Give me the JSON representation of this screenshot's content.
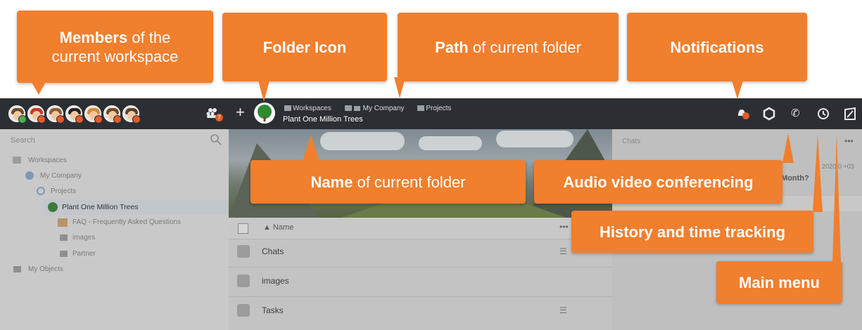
{
  "topbar": {
    "avatars": [
      {
        "hair": "#6b4a2b",
        "badge": "#4caf50"
      },
      {
        "hair": "#c0392b",
        "badge": "#e35b2b"
      },
      {
        "hair": "#8e5a3c",
        "badge": "#e35b2b"
      },
      {
        "hair": "#222222",
        "badge": "#e35b2b"
      },
      {
        "hair": "#d08a3a",
        "badge": "#e35b2b"
      },
      {
        "hair": "#6b4a2b",
        "badge": "#e35b2b"
      },
      {
        "hair": "#5a3d2b",
        "badge": "#e35b2b"
      }
    ],
    "members_count": "7",
    "breadcrumb": [
      "Workspaces",
      "My Company",
      "Projects"
    ],
    "folder_name": "Plant One Million Trees"
  },
  "left": {
    "search_placeholder": "Search",
    "tree": {
      "workspaces": "Workspaces",
      "my_company": "My Company",
      "projects": "Projects",
      "plant": "Plant One Million Trees",
      "faq": "FAQ - Frequently Asked Questions",
      "images": "images",
      "partner": "Partner",
      "my_objects": "My Objects"
    }
  },
  "middle": {
    "column_header": "Name",
    "rows": [
      "Chats",
      "images",
      "Tasks"
    ]
  },
  "right": {
    "title": "Chats",
    "date": "2020-0 +03",
    "month_fragment": "Month?"
  },
  "callouts": {
    "members_bold": "Members",
    "members_rest1": " of the",
    "members_rest2": "current workspace",
    "folder_icon": "Folder Icon",
    "path_bold": "Path",
    "path_rest": " of current folder",
    "notifications": "Notifications",
    "name_bold": "Name",
    "name_rest": " of current folder",
    "audio": "Audio video conferencing",
    "history": "History and time tracking",
    "main_menu": "Main menu"
  },
  "colors": {
    "accent": "#f07f2e",
    "topbar": "#2b2f33"
  }
}
